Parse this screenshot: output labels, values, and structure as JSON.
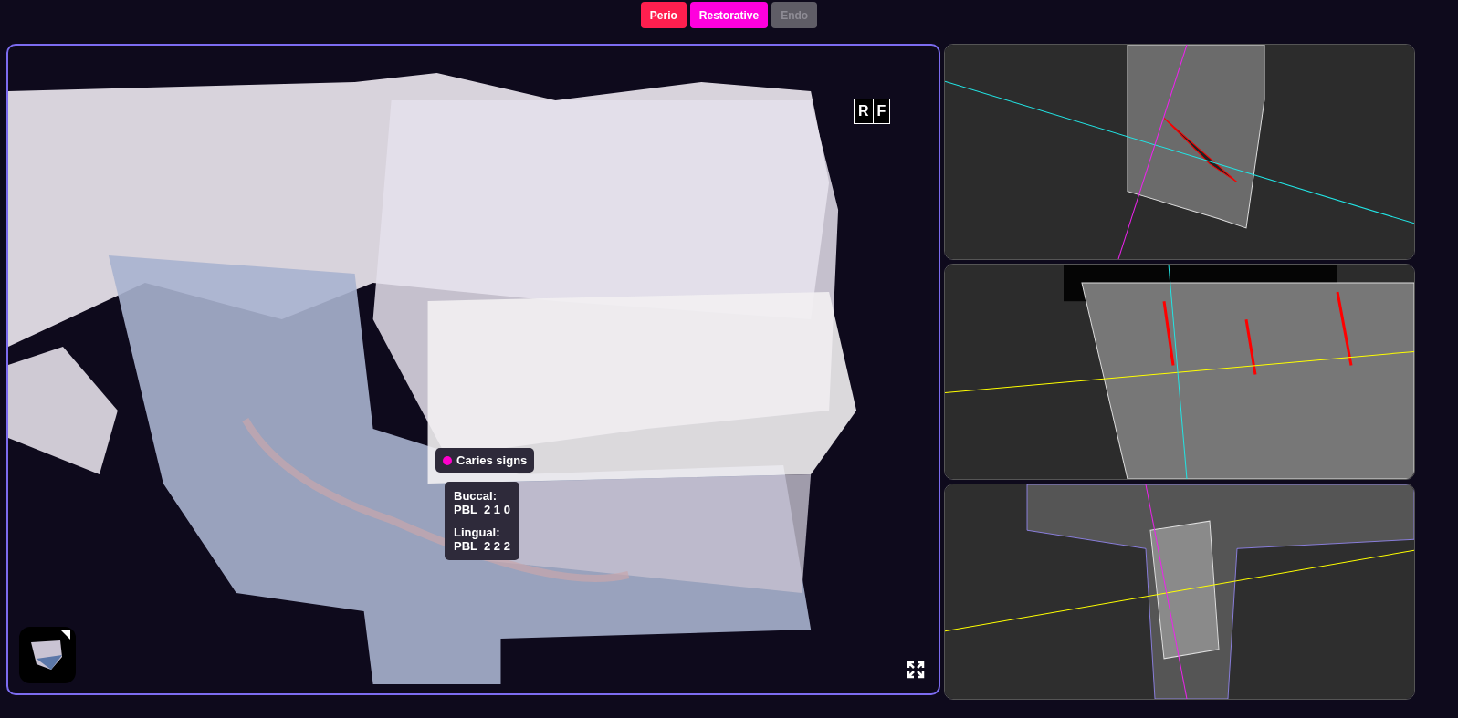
{
  "filters": [
    {
      "label": "Perio",
      "color": "#ff1f4f",
      "selected": true
    },
    {
      "label": "Restorative",
      "color": "#ff00dd",
      "selected": true
    },
    {
      "label": "Endo",
      "selected": false
    }
  ],
  "viewer": {
    "cube": [
      "R",
      "F"
    ],
    "finding": {
      "label": "Caries signs",
      "color": "#ff00cc"
    },
    "measurements": [
      {
        "side": "Buccal:",
        "values": "PBL  2 1 0"
      },
      {
        "side": "Lingual:",
        "values": "PBL  2 2 2"
      }
    ]
  }
}
